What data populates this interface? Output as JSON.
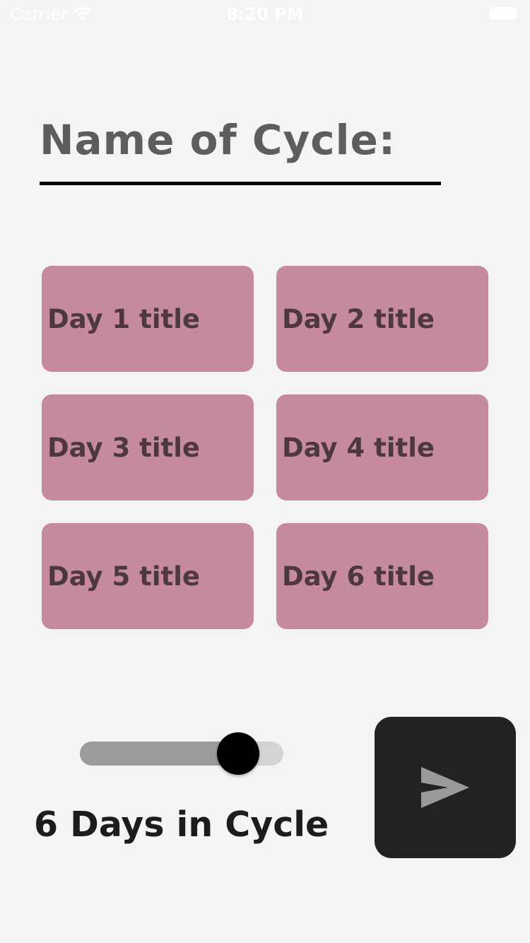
{
  "status_bar": {
    "carrier": "Carrier",
    "time": "8:20 PM"
  },
  "cycle": {
    "name_label": "Name of Cycle:"
  },
  "days": [
    {
      "label": "Day 1 title"
    },
    {
      "label": "Day 2 title"
    },
    {
      "label": "Day 3 title"
    },
    {
      "label": "Day 4 title"
    },
    {
      "label": "Day 5 title"
    },
    {
      "label": "Day 6 title"
    }
  ],
  "slider": {
    "value": 0.85
  },
  "days_in_cycle_label": "6 Days in Cycle",
  "send_button": {
    "icon": "send-icon"
  },
  "colors": {
    "background": "#f4f4f4",
    "day_card": "#c68a9e",
    "day_text": "#4d3840",
    "send_button": "#222222",
    "send_icon": "#9a9a9a"
  }
}
